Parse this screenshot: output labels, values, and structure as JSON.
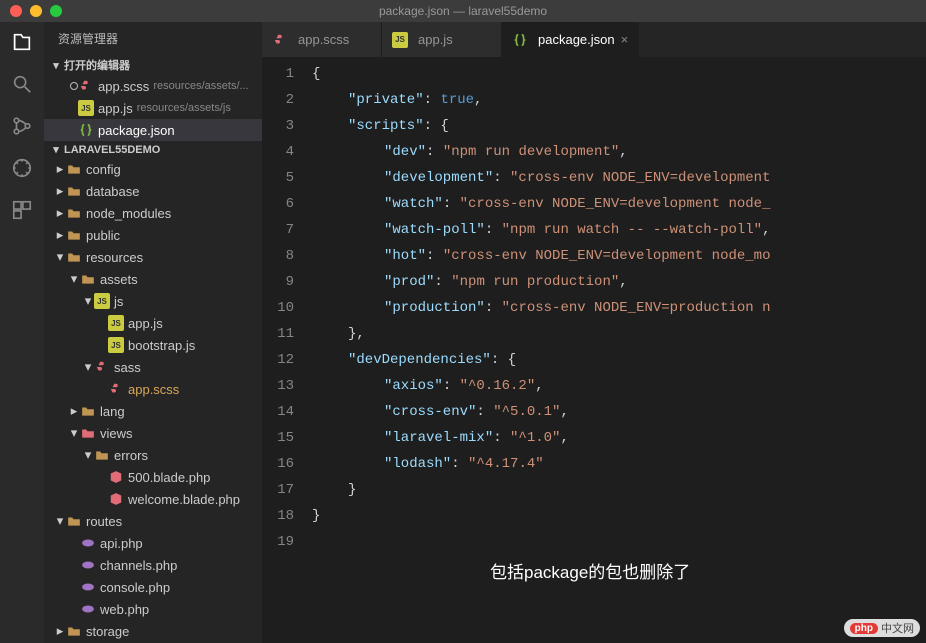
{
  "window": {
    "title": "package.json — laravel55demo"
  },
  "sidebar": {
    "title": "资源管理器",
    "open_editors_label": "打开的编辑器",
    "project_label": "LARAVEL55DEMO",
    "open_editors": [
      {
        "name": "app.scss",
        "path": "resources/assets/...",
        "icon": "sass",
        "dirty": true
      },
      {
        "name": "app.js",
        "path": "resources/assets/js",
        "icon": "js",
        "dirty": false
      },
      {
        "name": "package.json",
        "path": "",
        "icon": "json",
        "dirty": false,
        "active": true
      }
    ],
    "tree": [
      {
        "depth": 0,
        "type": "folder",
        "name": "config",
        "expanded": false
      },
      {
        "depth": 0,
        "type": "folder",
        "name": "database",
        "expanded": false
      },
      {
        "depth": 0,
        "type": "folder",
        "name": "node_modules",
        "expanded": false
      },
      {
        "depth": 0,
        "type": "folder",
        "name": "public",
        "expanded": false
      },
      {
        "depth": 0,
        "type": "folder",
        "name": "resources",
        "expanded": true
      },
      {
        "depth": 1,
        "type": "folder",
        "name": "assets",
        "expanded": true
      },
      {
        "depth": 2,
        "type": "folder-js",
        "name": "js",
        "expanded": true
      },
      {
        "depth": 3,
        "type": "file-js",
        "name": "app.js"
      },
      {
        "depth": 3,
        "type": "file-js",
        "name": "bootstrap.js"
      },
      {
        "depth": 2,
        "type": "folder-sass",
        "name": "sass",
        "expanded": true
      },
      {
        "depth": 3,
        "type": "file-sass",
        "name": "app.scss",
        "modified": true
      },
      {
        "depth": 1,
        "type": "folder",
        "name": "lang",
        "expanded": false
      },
      {
        "depth": 1,
        "type": "folder-red",
        "name": "views",
        "expanded": true
      },
      {
        "depth": 2,
        "type": "folder",
        "name": "errors",
        "expanded": true
      },
      {
        "depth": 3,
        "type": "file-blade",
        "name": "500.blade.php"
      },
      {
        "depth": 3,
        "type": "file-blade",
        "name": "welcome.blade.php"
      },
      {
        "depth": 0,
        "type": "folder",
        "name": "routes",
        "expanded": true
      },
      {
        "depth": 1,
        "type": "file-php",
        "name": "api.php"
      },
      {
        "depth": 1,
        "type": "file-php",
        "name": "channels.php"
      },
      {
        "depth": 1,
        "type": "file-php",
        "name": "console.php"
      },
      {
        "depth": 1,
        "type": "file-php",
        "name": "web.php"
      },
      {
        "depth": 0,
        "type": "folder",
        "name": "storage",
        "expanded": false
      }
    ]
  },
  "tabs": [
    {
      "name": "app.scss",
      "icon": "sass",
      "active": false
    },
    {
      "name": "app.js",
      "icon": "js",
      "active": false
    },
    {
      "name": "package.json",
      "icon": "json",
      "active": true,
      "close": "×"
    }
  ],
  "code": {
    "lines": [
      {
        "n": 1,
        "segs": [
          {
            "t": "{",
            "c": "brace"
          }
        ]
      },
      {
        "n": 2,
        "ind": 1,
        "segs": [
          {
            "t": "\"private\"",
            "c": "key"
          },
          {
            "t": ": ",
            "c": "punct"
          },
          {
            "t": "true",
            "c": "const"
          },
          {
            "t": ",",
            "c": "punct"
          }
        ]
      },
      {
        "n": 3,
        "ind": 1,
        "segs": [
          {
            "t": "\"scripts\"",
            "c": "key"
          },
          {
            "t": ": {",
            "c": "punct"
          }
        ]
      },
      {
        "n": 4,
        "ind": 2,
        "segs": [
          {
            "t": "\"dev\"",
            "c": "key"
          },
          {
            "t": ": ",
            "c": "punct"
          },
          {
            "t": "\"npm run development\"",
            "c": "str"
          },
          {
            "t": ",",
            "c": "punct"
          }
        ]
      },
      {
        "n": 5,
        "ind": 2,
        "segs": [
          {
            "t": "\"development\"",
            "c": "key"
          },
          {
            "t": ": ",
            "c": "punct"
          },
          {
            "t": "\"cross-env NODE_ENV=development",
            "c": "str"
          }
        ]
      },
      {
        "n": 6,
        "ind": 2,
        "segs": [
          {
            "t": "\"watch\"",
            "c": "key"
          },
          {
            "t": ": ",
            "c": "punct"
          },
          {
            "t": "\"cross-env NODE_ENV=development node_",
            "c": "str"
          }
        ]
      },
      {
        "n": 7,
        "ind": 2,
        "segs": [
          {
            "t": "\"watch-poll\"",
            "c": "key"
          },
          {
            "t": ": ",
            "c": "punct"
          },
          {
            "t": "\"npm run watch -- --watch-poll\"",
            "c": "str"
          },
          {
            "t": ",",
            "c": "punct"
          }
        ]
      },
      {
        "n": 8,
        "ind": 2,
        "segs": [
          {
            "t": "\"hot\"",
            "c": "key"
          },
          {
            "t": ": ",
            "c": "punct"
          },
          {
            "t": "\"cross-env NODE_ENV=development node_mo",
            "c": "str"
          }
        ]
      },
      {
        "n": 9,
        "ind": 2,
        "segs": [
          {
            "t": "\"prod\"",
            "c": "key"
          },
          {
            "t": ": ",
            "c": "punct"
          },
          {
            "t": "\"npm run production\"",
            "c": "str"
          },
          {
            "t": ",",
            "c": "punct"
          }
        ]
      },
      {
        "n": 10,
        "ind": 2,
        "segs": [
          {
            "t": "\"production\"",
            "c": "key"
          },
          {
            "t": ": ",
            "c": "punct"
          },
          {
            "t": "\"cross-env NODE_ENV=production n",
            "c": "str"
          }
        ]
      },
      {
        "n": 11,
        "ind": 1,
        "segs": [
          {
            "t": "},",
            "c": "punct"
          }
        ]
      },
      {
        "n": 12,
        "ind": 1,
        "segs": [
          {
            "t": "\"devDependencies\"",
            "c": "key"
          },
          {
            "t": ": {",
            "c": "punct"
          }
        ]
      },
      {
        "n": 13,
        "ind": 2,
        "segs": [
          {
            "t": "\"axios\"",
            "c": "key"
          },
          {
            "t": ": ",
            "c": "punct"
          },
          {
            "t": "\"^0.16.2\"",
            "c": "str"
          },
          {
            "t": ",",
            "c": "punct"
          }
        ]
      },
      {
        "n": 14,
        "ind": 2,
        "segs": [
          {
            "t": "\"cross-env\"",
            "c": "key"
          },
          {
            "t": ": ",
            "c": "punct"
          },
          {
            "t": "\"^5.0.1\"",
            "c": "str"
          },
          {
            "t": ",",
            "c": "punct"
          }
        ]
      },
      {
        "n": 15,
        "ind": 2,
        "segs": [
          {
            "t": "\"laravel-mix\"",
            "c": "key"
          },
          {
            "t": ": ",
            "c": "punct"
          },
          {
            "t": "\"^1.0\"",
            "c": "str"
          },
          {
            "t": ",",
            "c": "punct"
          }
        ]
      },
      {
        "n": 16,
        "ind": 2,
        "segs": [
          {
            "t": "\"lodash\"",
            "c": "key"
          },
          {
            "t": ": ",
            "c": "punct"
          },
          {
            "t": "\"^4.17.4\"",
            "c": "str"
          }
        ]
      },
      {
        "n": 17,
        "ind": 1,
        "segs": [
          {
            "t": "}",
            "c": "punct"
          }
        ]
      },
      {
        "n": 18,
        "segs": [
          {
            "t": "}",
            "c": "brace"
          }
        ]
      },
      {
        "n": 19,
        "segs": []
      }
    ]
  },
  "annotation": "包括package的包也删除了",
  "watermark": {
    "badge": "php",
    "text": "中文网"
  }
}
